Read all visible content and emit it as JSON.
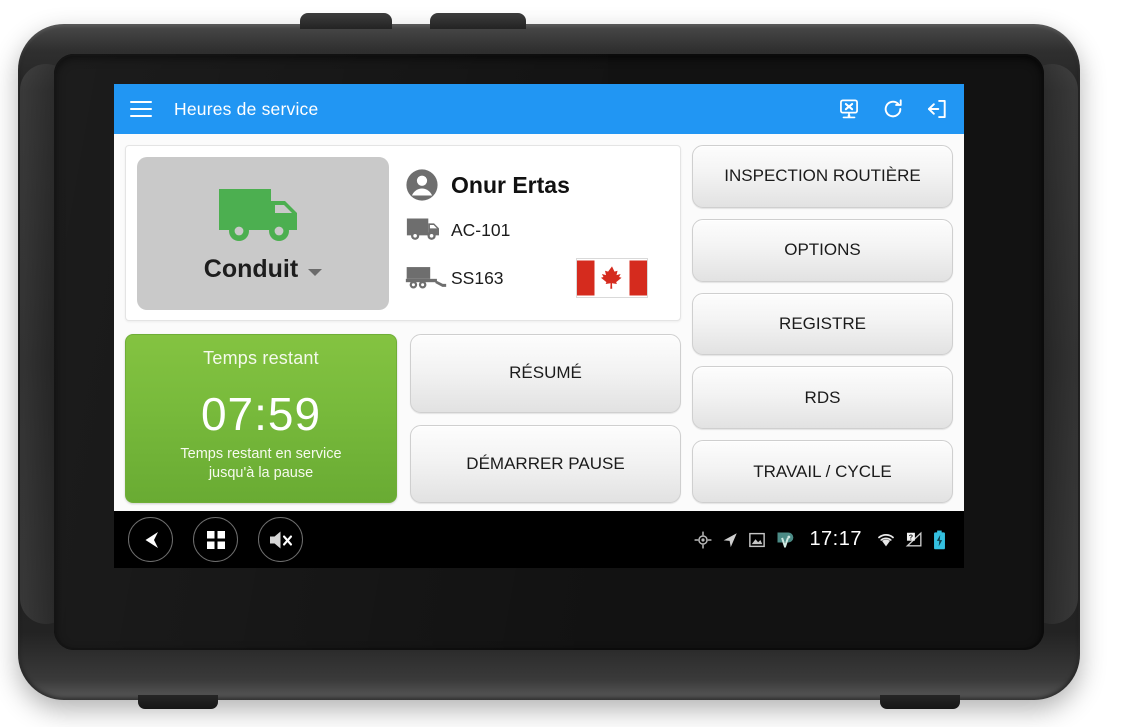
{
  "app": {
    "title": "Heures de service",
    "menu_icon": "hamburger-menu-icon",
    "actions": [
      {
        "name": "eld-disconnected-icon",
        "label": "Appareil déconnecté"
      },
      {
        "name": "refresh-icon",
        "label": "Actualiser"
      },
      {
        "name": "logout-icon",
        "label": "Déconnexion"
      }
    ]
  },
  "driver_card": {
    "duty_status": {
      "label": "Conduit",
      "icon": "green-truck-icon",
      "color": "#4CAF50",
      "has_dropdown": true
    },
    "driver_name": "Onur Ertas",
    "driver_icon": "account-circle-icon",
    "vehicle": "AC-101",
    "vehicle_icon": "truck-icon",
    "trailer": "SS163",
    "trailer_icon": "trailer-icon",
    "country_flag": "canada-flag",
    "flag_colors": {
      "red": "#D52B1E",
      "white": "#FFFFFF"
    }
  },
  "timer": {
    "title": "Temps restant",
    "value": "07:59",
    "subtitle_line1": "Temps restant en service",
    "subtitle_line2": "jusqu'à la pause",
    "color": "#79bb3c"
  },
  "middle_buttons": [
    {
      "label": "RÉSUMÉ",
      "name": "resume-button"
    },
    {
      "label": "DÉMARRER PAUSE",
      "name": "start-break-button"
    }
  ],
  "right_buttons": [
    {
      "label": "INSPECTION ROUTIÈRE",
      "name": "roadside-inspection-button"
    },
    {
      "label": "OPTIONS",
      "name": "options-button"
    },
    {
      "label": "REGISTRE",
      "name": "logbook-button"
    },
    {
      "label": "RDS",
      "name": "rds-button"
    },
    {
      "label": "TRAVAIL / CYCLE",
      "name": "work-cycle-button"
    }
  ],
  "navbar": {
    "keys": [
      {
        "name": "back-button",
        "icon": "back-arrow-icon"
      },
      {
        "name": "apps-button",
        "icon": "apps-grid-icon"
      },
      {
        "name": "volume-mute-button",
        "icon": "volume-off-icon"
      }
    ],
    "status_icons_left": [
      "location-crosshair-icon",
      "navigation-arrow-icon",
      "image-icon",
      "app-teal-icon"
    ],
    "clock": "17:17",
    "status_icons_right": [
      "wifi-icon",
      "signal-unknown-icon",
      "battery-charging-icon"
    ]
  },
  "theme": {
    "appbar_color": "#2196F3",
    "screen_background": "#fbfbfb",
    "navbar_color": "#000000"
  }
}
